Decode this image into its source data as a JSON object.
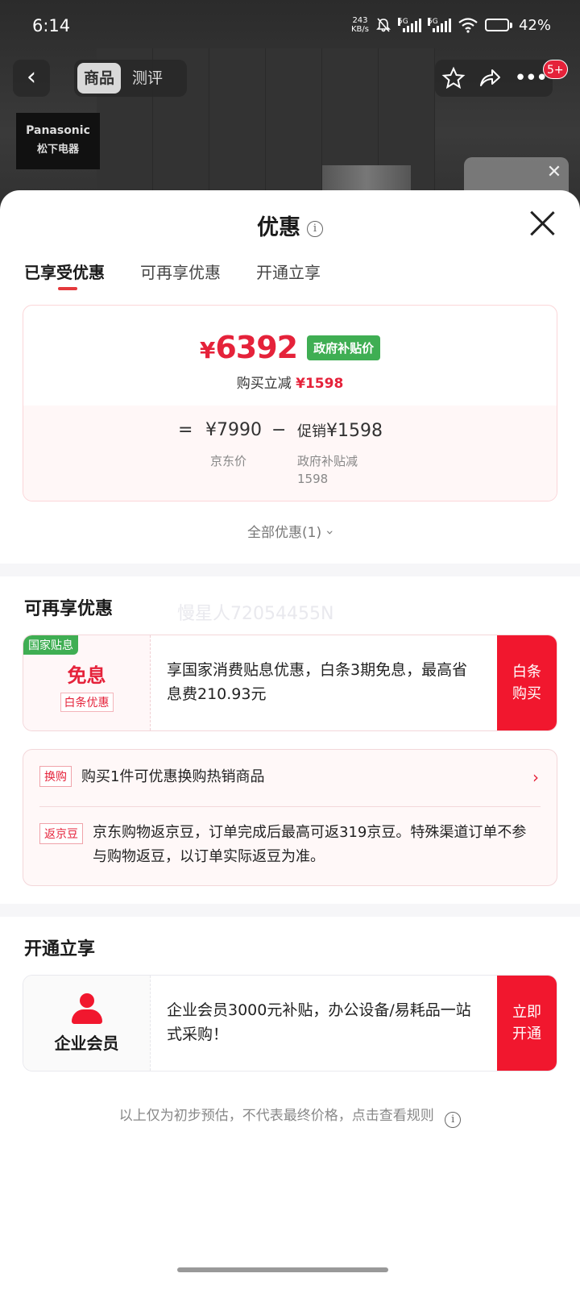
{
  "status_bar": {
    "time": "6:14",
    "net_speed_value": "243",
    "net_speed_unit": "KB/s",
    "signal_tag_1": "5G",
    "signal_tag_2": "5G",
    "battery_percent": "42%",
    "battery_level": 0.42
  },
  "nav": {
    "segment": [
      "商品",
      "测评"
    ],
    "active_segment": 0,
    "badge": "5+"
  },
  "brand": {
    "en": "Panasonic",
    "cn": "松下电器"
  },
  "sheet": {
    "title": "优惠",
    "tabs": [
      "已享受优惠",
      "可再享优惠",
      "开通立享"
    ],
    "active_tab": 0
  },
  "price_card": {
    "currency": "¥",
    "final_price": "6392",
    "tag": "政府补贴价",
    "reduce_label": "购买立减",
    "reduce_value": "¥1598",
    "eq": "=",
    "jd_price": "¥7990",
    "minus": "−",
    "promo_label": "促销",
    "promo_value": "¥1598",
    "jd_price_label": "京东价",
    "promo_detail_line1": "政府补贴减",
    "promo_detail_line2": "1598"
  },
  "all_promos": "全部优惠(1)",
  "more_section": {
    "title": "可再享优惠",
    "watermark": "慢星人72054455N",
    "offer": {
      "corner_tag": "国家贴息",
      "big": "免息",
      "small": "白条优惠",
      "desc": "享国家消费贴息优惠，白条3期免息，最高省息费210.93元",
      "action_line1": "白条",
      "action_line2": "购买"
    },
    "promos": [
      {
        "chip": "换购",
        "text": "购买1件可优惠换购热销商品"
      },
      {
        "chip": "返京豆",
        "text": "京东购物返京豆，订单完成后最高可返319京豆。特殊渠道订单不参与购物返豆，以订单实际返豆为准。"
      }
    ]
  },
  "open_section": {
    "title": "开通立享",
    "member": {
      "label": "企业会员",
      "desc": "企业会员3000元补贴，办公设备/易耗品一站式采购！",
      "action_line1": "立即",
      "action_line2": "开通"
    }
  },
  "disclaimer": "以上仅为初步预估，不代表最终价格，点击查看规则",
  "colors": {
    "accent_red": "#E5223A",
    "button_red": "#F1172E",
    "green_tag": "#3FAE53"
  }
}
